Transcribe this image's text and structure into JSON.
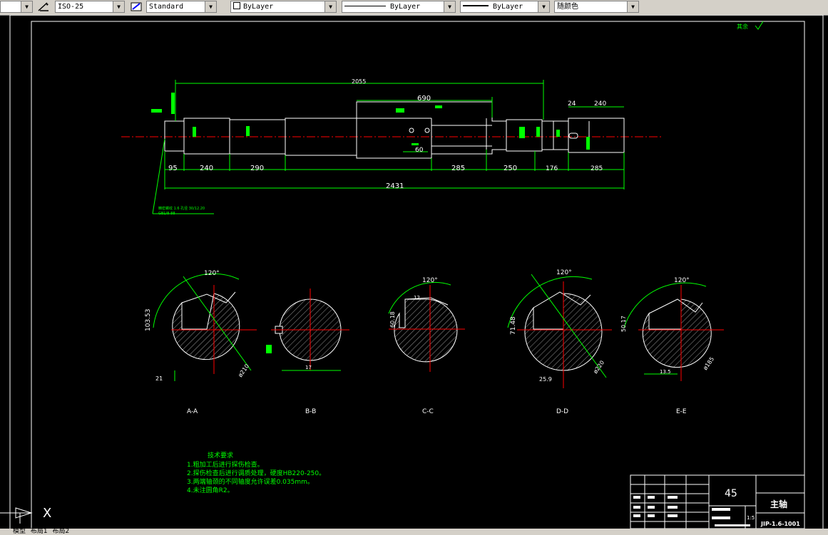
{
  "toolbar": {
    "dimstyle": "ISO-25",
    "textstyle": "Standard",
    "layer": "ByLayer",
    "linetype": "ByLayer",
    "lineweight": "ByLayer",
    "color": "随颜色"
  },
  "drawing": {
    "roughness_note": "其余",
    "dims_top": [
      "2055",
      "690",
      "24",
      "240"
    ],
    "dims_bottom": [
      "95",
      "240",
      "290",
      "285",
      "250",
      "176",
      "285"
    ],
    "dim_overall": "2431",
    "dim_small": "60",
    "note_thread": "精密螺纹 1.6 孔径 30/12.20",
    "note_gb": "GB1/8-88",
    "sections": [
      {
        "label": "A-A",
        "angle": "120°",
        "dim_depth": "103.53",
        "dim_width": "21",
        "dim_dia": "ø210"
      },
      {
        "label": "B-B",
        "dim_width": "17"
      },
      {
        "label": "C-C",
        "angle": "120°",
        "dim_depth": "60.18",
        "dim_width": "12"
      },
      {
        "label": "D-D",
        "angle": "120°",
        "dim_depth": "71.48",
        "dim_width": "25.9",
        "dim_dia": "ø220"
      },
      {
        "label": "E-E",
        "angle": "120°",
        "dim_depth": "50.17",
        "dim_width": "13.5",
        "dim_dia": "ø185"
      }
    ],
    "tech_title": "技术要求",
    "tech_items": [
      "1.粗加工后进行探伤检查。",
      "2.探伤检查后进行调质处理，硬度HB220-250。",
      "3.两端轴颈的不同轴度允许误差0.035mm。",
      "4.未注圆角R2。"
    ],
    "titleblock": {
      "material": "45",
      "name": "主轴",
      "scale": "1:5",
      "code": "JIP-1.6-1001"
    }
  },
  "ucs_label": "X",
  "layout_tabs": [
    "模型",
    "布局1",
    "布局2"
  ],
  "colors": {
    "background": "#000000",
    "green": "#00ff00",
    "white": "#ffffff",
    "red": "#ff0000"
  }
}
